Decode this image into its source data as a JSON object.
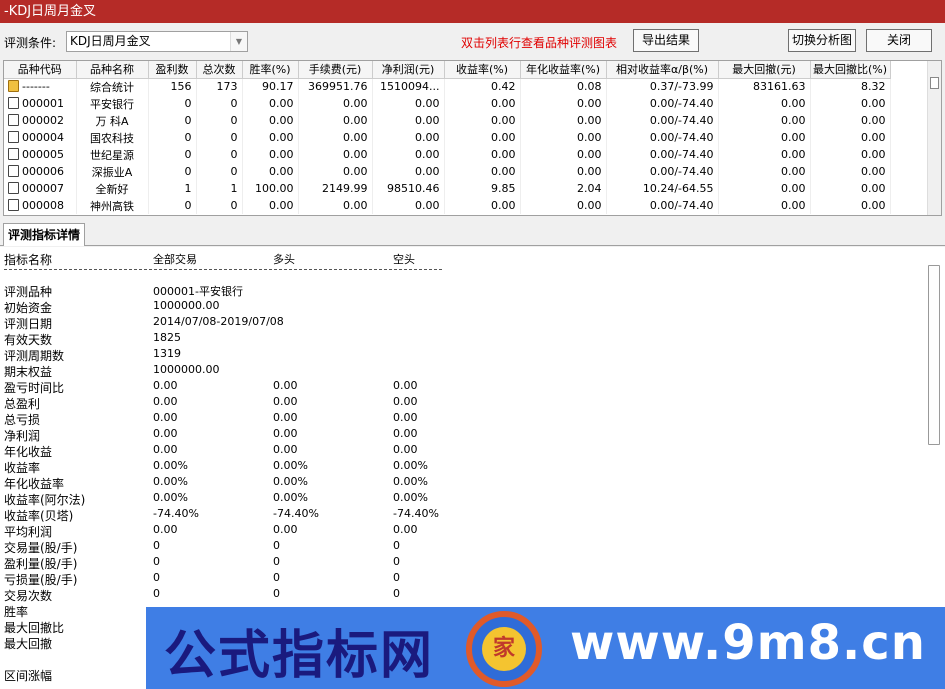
{
  "window": {
    "title": "-KDJ日周月金叉"
  },
  "toolbar": {
    "condition_label": "评测条件:",
    "condition_value": "KDJ日周月金叉",
    "hint": "双击列表行查看品种评测图表",
    "export_label": "导出结果",
    "switch_label": "切换分析图",
    "close_label": "关闭"
  },
  "grid": {
    "headers": [
      "品种代码",
      "品种名称",
      "盈利数",
      "总次数",
      "胜率(%)",
      "手续费(元)",
      "净利润(元)",
      "收益率(%)",
      "年化收益率(%)",
      "相对收益率α/β(%)",
      "最大回撤(元)",
      "最大回撤比(%)"
    ],
    "rows": [
      [
        "-------",
        "综合统计",
        "156",
        "173",
        "90.17",
        "369951.76",
        "1510094...",
        "0.42",
        "0.08",
        "0.37/-73.99",
        "83161.63",
        "8.32"
      ],
      [
        "000001",
        "平安银行",
        "0",
        "0",
        "0.00",
        "0.00",
        "0.00",
        "0.00",
        "0.00",
        "0.00/-74.40",
        "0.00",
        "0.00"
      ],
      [
        "000002",
        "万 科A",
        "0",
        "0",
        "0.00",
        "0.00",
        "0.00",
        "0.00",
        "0.00",
        "0.00/-74.40",
        "0.00",
        "0.00"
      ],
      [
        "000004",
        "国农科技",
        "0",
        "0",
        "0.00",
        "0.00",
        "0.00",
        "0.00",
        "0.00",
        "0.00/-74.40",
        "0.00",
        "0.00"
      ],
      [
        "000005",
        "世纪星源",
        "0",
        "0",
        "0.00",
        "0.00",
        "0.00",
        "0.00",
        "0.00",
        "0.00/-74.40",
        "0.00",
        "0.00"
      ],
      [
        "000006",
        "深振业A",
        "0",
        "0",
        "0.00",
        "0.00",
        "0.00",
        "0.00",
        "0.00",
        "0.00/-74.40",
        "0.00",
        "0.00"
      ],
      [
        "000007",
        "全新好",
        "1",
        "1",
        "100.00",
        "2149.99",
        "98510.46",
        "9.85",
        "2.04",
        "10.24/-64.55",
        "0.00",
        "0.00"
      ],
      [
        "000008",
        "神州高铁",
        "0",
        "0",
        "0.00",
        "0.00",
        "0.00",
        "0.00",
        "0.00",
        "0.00/-74.40",
        "0.00",
        "0.00"
      ]
    ]
  },
  "details": {
    "tab_label": "评测指标详情",
    "header": [
      "指标名称",
      "全部交易",
      "多头",
      "空头"
    ],
    "rows": [
      [
        "评测品种",
        "000001-平安银行",
        "",
        ""
      ],
      [
        "初始资金",
        "1000000.00",
        "",
        ""
      ],
      [
        "评测日期",
        "2014/07/08-2019/07/08",
        "",
        ""
      ],
      [
        "有效天数",
        "1825",
        "",
        ""
      ],
      [
        "评测周期数",
        "1319",
        "",
        ""
      ],
      [
        "期末权益",
        "1000000.00",
        "",
        ""
      ],
      [
        "盈亏时间比",
        "0.00",
        "0.00",
        "0.00"
      ],
      [
        "总盈利",
        "0.00",
        "0.00",
        "0.00"
      ],
      [
        "总亏损",
        "0.00",
        "0.00",
        "0.00"
      ],
      [
        "净利润",
        "0.00",
        "0.00",
        "0.00"
      ],
      [
        "年化收益",
        "0.00",
        "0.00",
        "0.00"
      ],
      [
        "收益率",
        "0.00%",
        "0.00%",
        "0.00%"
      ],
      [
        "年化收益率",
        "0.00%",
        "0.00%",
        "0.00%"
      ],
      [
        "收益率(阿尔法)",
        "0.00%",
        "0.00%",
        "0.00%"
      ],
      [
        "收益率(贝塔)",
        "-74.40%",
        "-74.40%",
        "-74.40%"
      ],
      [
        "平均利润",
        "0.00",
        "0.00",
        "0.00"
      ],
      [
        "交易量(股/手)",
        "0",
        "0",
        "0"
      ],
      [
        "盈利量(股/手)",
        "0",
        "0",
        "0"
      ],
      [
        "亏损量(股/手)",
        "0",
        "0",
        "0"
      ],
      [
        "交易次数",
        "0",
        "0",
        "0"
      ],
      [
        "胜率",
        "",
        "",
        ""
      ],
      [
        "最大回撤比",
        "",
        "",
        ""
      ],
      [
        "最大回撤",
        "",
        "",
        ""
      ],
      [
        "",
        "",
        "",
        ""
      ],
      [
        "区间涨幅",
        "",
        "",
        ""
      ]
    ]
  },
  "banner": {
    "text": "公式指标网",
    "url": "www.9m8.cn",
    "logo_char": "家"
  }
}
